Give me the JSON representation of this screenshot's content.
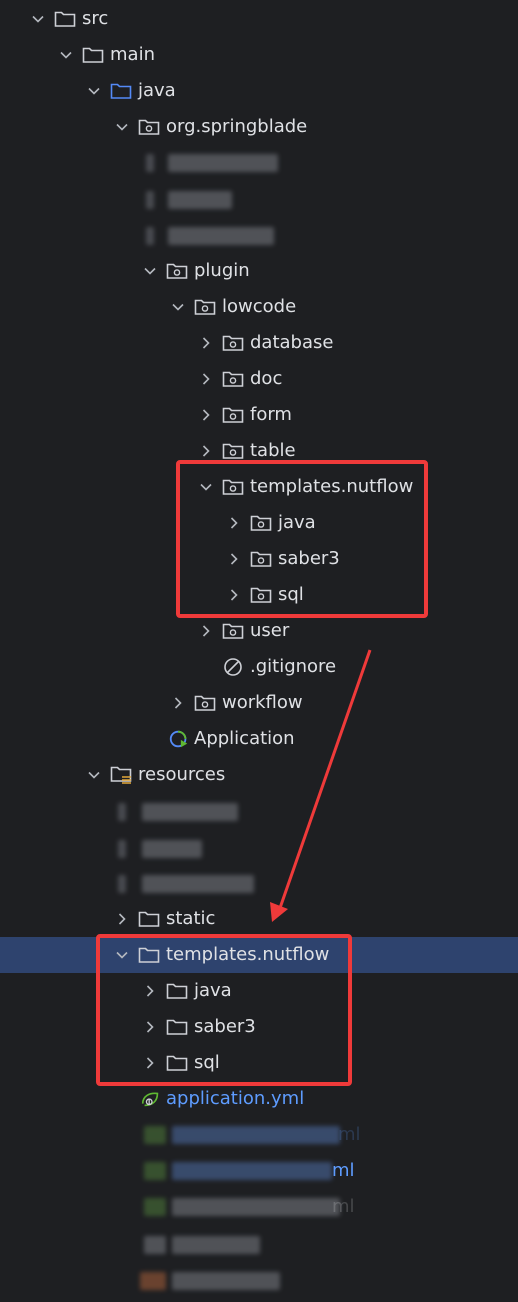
{
  "tree": {
    "src": "src",
    "main": "main",
    "java": "java",
    "org_springblade": "org.springblade",
    "plugin": "plugin",
    "lowcode": "lowcode",
    "database": "database",
    "doc": "doc",
    "form": "form",
    "table": "table",
    "templates_nutflow_pkg": "templates.nutflow",
    "pkg_java": "java",
    "pkg_saber3": "saber3",
    "pkg_sql": "sql",
    "user": "user",
    "gitignore": ".gitignore",
    "workflow": "workflow",
    "application_class": "Application",
    "resources": "resources",
    "static": "static",
    "templates_nutflow_res": "templates.nutflow",
    "res_java": "java",
    "res_saber3": "saber3",
    "res_sql": "sql",
    "application_yml": "application.yml",
    "yml_suffix_1": "ml",
    "yml_suffix_2": "ml",
    "yml_suffix_3": "ml"
  },
  "colors": {
    "background": "#1e1f22",
    "selected_row": "#2e436e",
    "text": "#dfe1e5",
    "file_link": "#5e9cff",
    "annotation_red": "#ef3a3a"
  }
}
